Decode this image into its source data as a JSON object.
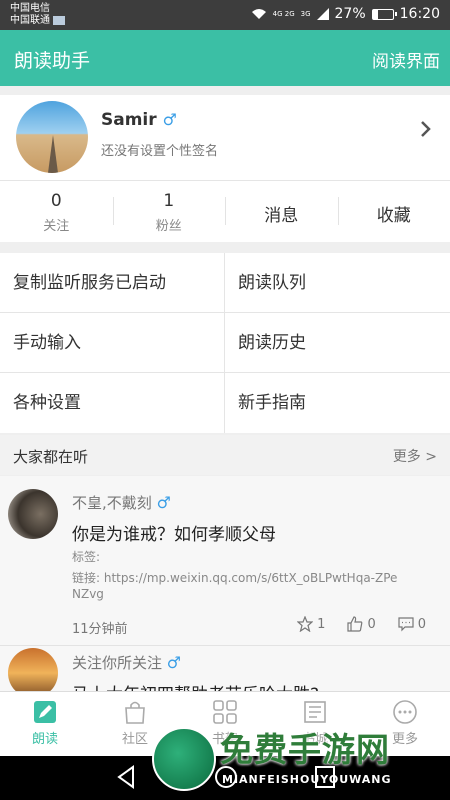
{
  "status_bar": {
    "carrier1": "中国电信",
    "carrier2": "中国联通",
    "network": "4G 2G",
    "network2": "3G",
    "battery_text": "27%",
    "battery_level": 0.27,
    "time": "16:20"
  },
  "app_bar": {
    "title": "朗读助手",
    "right_action": "阅读界面"
  },
  "profile": {
    "name": "Samir",
    "gender_symbol": "♂",
    "signature": "还没有设置个性签名",
    "stats": [
      {
        "value": "0",
        "label": "关注"
      },
      {
        "value": "1",
        "label": "粉丝"
      }
    ],
    "messages_label": "消息",
    "favorites_label": "收藏"
  },
  "menu": {
    "items": [
      "复制监听服务已启动",
      "朗读队列",
      "手动输入",
      "朗读历史",
      "各种设置",
      "新手指南"
    ]
  },
  "section": {
    "title": "大家都在听",
    "more": "更多 >"
  },
  "feed": {
    "posts": [
      {
        "author": "不皇,不戴刻",
        "gender_symbol": "♂",
        "title": "你是为谁戒？如何孝顺父母",
        "tags": "标签:",
        "link": "链接: https://mp.weixin.qq.com/s/6ttX_oBLPwtHqa-ZPeNZvg",
        "time": "11分钟前",
        "stars": "1",
        "likes": "0",
        "comments": "0"
      },
      {
        "author": "关注你所关注",
        "gender_symbol": "♂",
        "title": "马上大年初四帮助老苗乐哈大胜?"
      }
    ]
  },
  "tabbar": {
    "tabs": [
      "朗读",
      "社区",
      "书架",
      "书城",
      "更多"
    ],
    "active": "朗读"
  },
  "watermark": {
    "text": "免费手游网",
    "sub": "MIANFEISHOUYOUWANG"
  }
}
